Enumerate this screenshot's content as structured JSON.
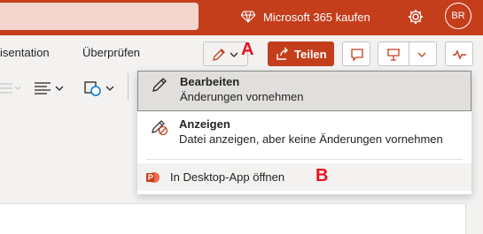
{
  "topbar": {
    "buy_label": "Microsoft 365 kaufen",
    "avatar_initials": "BR"
  },
  "menu": {
    "tabs": [
      "isentation",
      "Überprüfen"
    ]
  },
  "toolbar": {
    "annotation_a": "A",
    "share_label": "Teilen"
  },
  "dropdown": {
    "items": [
      {
        "title": "Bearbeiten",
        "subtitle": "Änderungen vornehmen"
      },
      {
        "title": "Anzeigen",
        "subtitle": "Datei anzeigen, aber keine Änderungen vornehmen"
      },
      {
        "label": "In Desktop-App öffnen"
      }
    ],
    "annotation_b": "B"
  },
  "colors": {
    "brand": "#c43e1c",
    "annotation": "#e81123"
  }
}
